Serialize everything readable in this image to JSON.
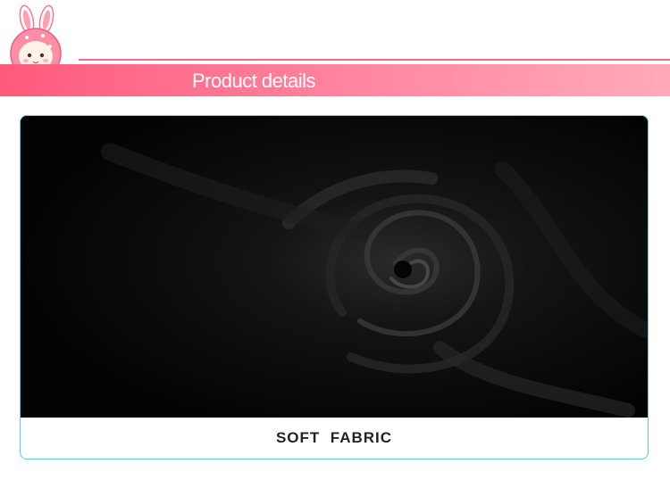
{
  "header": {
    "title": "Product details",
    "accent_color": "#ff6b87",
    "mascot_icon": "bunny-mascot-icon"
  },
  "card": {
    "caption": "SOFT  FABRIC",
    "image": "black-fabric-swirl-photo",
    "border_color": "#5fcde0"
  }
}
